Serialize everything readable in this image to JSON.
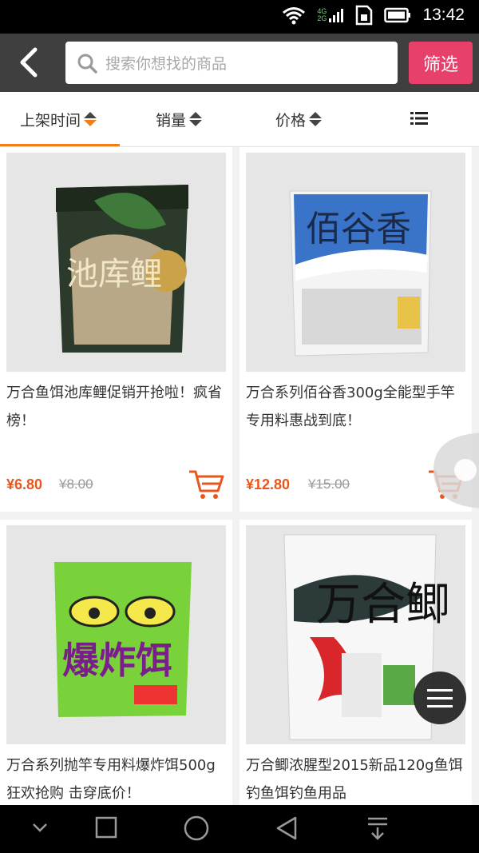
{
  "status_bar": {
    "time": "13:42",
    "network": [
      "4G",
      "2G"
    ]
  },
  "header": {
    "search_placeholder": "搜索你想找的商品",
    "filter_label": "筛选"
  },
  "sort_tabs": [
    {
      "label": "上架时间",
      "active": true
    },
    {
      "label": "销量",
      "active": false
    },
    {
      "label": "价格",
      "active": false
    }
  ],
  "products": [
    {
      "title": "万合鱼饵池库鲤促销开抢啦！疯省榜！",
      "price": "¥6.80",
      "old_price": "¥8.00",
      "package_text": "池库鲤"
    },
    {
      "title": "万合系列佰谷香300g全能型手竿专用料惠战到底！",
      "price": "¥12.80",
      "old_price": "¥15.00",
      "package_text": "佰谷香"
    },
    {
      "title": "万合系列抛竿专用料爆炸饵500g狂欢抢购 击穿底价！",
      "price": "",
      "old_price": "",
      "package_text": "爆炸饵"
    },
    {
      "title": "万合鲫浓腥型2015新品120g鱼饵钓鱼饵钓鱼用品",
      "price": "",
      "old_price": "",
      "package_text": "万合鲫"
    }
  ],
  "colors": {
    "accent": "#f07f1a",
    "filter": "#e6406b",
    "price": "#e8571c",
    "header": "#3f3f3f"
  }
}
